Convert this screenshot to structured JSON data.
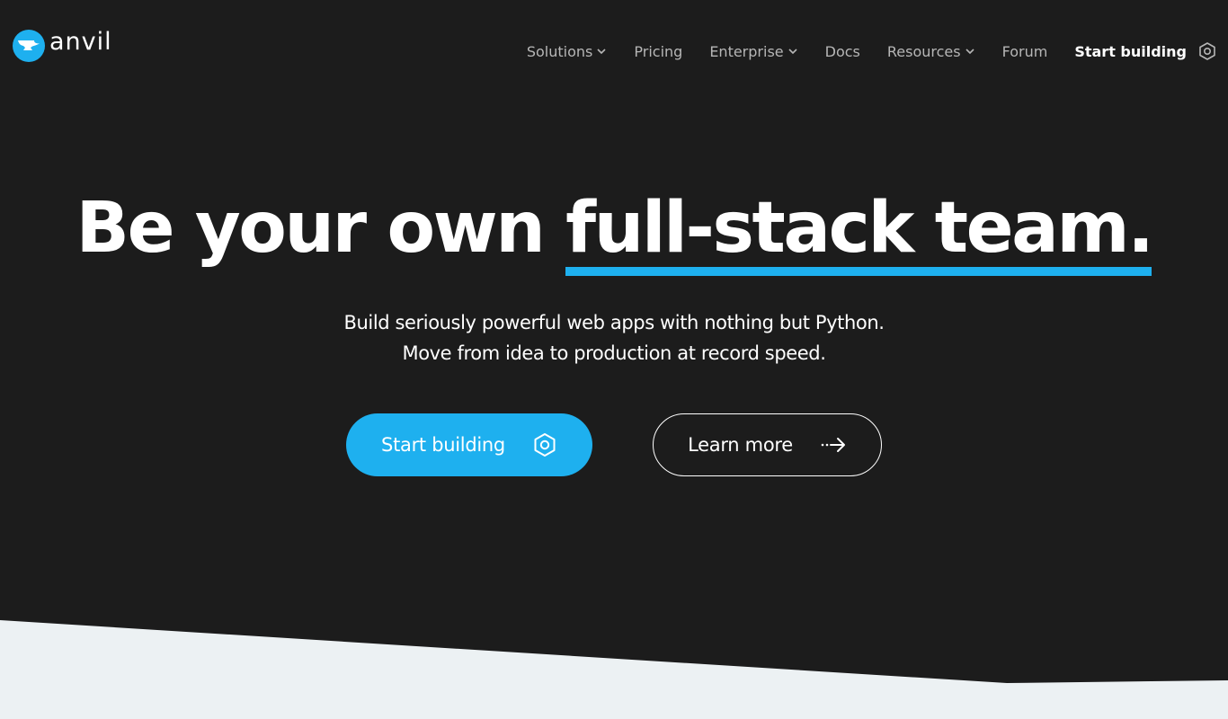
{
  "brand": {
    "name": "anvil",
    "accent_color": "#1eb0ef",
    "icon": "anvil-logo-icon"
  },
  "nav": {
    "items": [
      {
        "label": "Solutions",
        "dropdown": true
      },
      {
        "label": "Pricing",
        "dropdown": false
      },
      {
        "label": "Enterprise",
        "dropdown": true
      },
      {
        "label": "Docs",
        "dropdown": false
      },
      {
        "label": "Resources",
        "dropdown": true
      },
      {
        "label": "Forum",
        "dropdown": false
      }
    ],
    "cta_label": "Start building",
    "cta_icon": "hexagon-icon"
  },
  "hero": {
    "title_plain": "Be your own ",
    "title_highlight": "full-stack team.",
    "subtitle_line1": "Build seriously powerful web apps with nothing but Python.",
    "subtitle_line2": "Move from idea to production at record speed.",
    "primary_button": {
      "label": "Start building",
      "icon": "hexagon-icon"
    },
    "secondary_button": {
      "label": "Learn more",
      "icon": "arrow-right-icon"
    }
  },
  "colors": {
    "background": "#1c1c1c",
    "bottom_section": "#ecf1f3",
    "nav_text": "#b6b6b6"
  }
}
